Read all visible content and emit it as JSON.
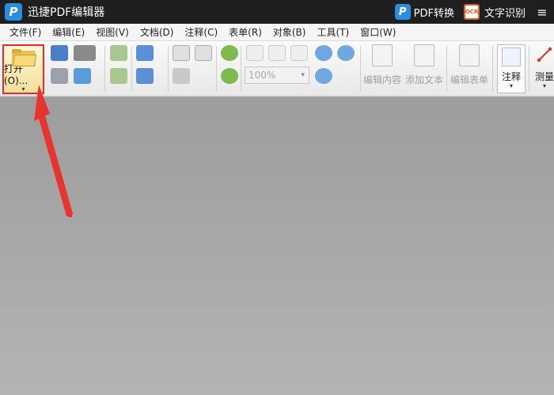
{
  "titlebar": {
    "logo_letter": "P",
    "title": "迅捷PDF编辑器",
    "pdf_convert_icon_letter": "P",
    "pdf_convert_label": "PDF转换",
    "ocr_icon_text": "OCR",
    "ocr_label": "文字识别",
    "menu_icon": "≡"
  },
  "menubar": {
    "items": [
      "文件(F)",
      "编辑(E)",
      "视图(V)",
      "文档(D)",
      "注释(C)",
      "表单(R)",
      "对象(B)",
      "工具(T)",
      "窗口(W)"
    ]
  },
  "toolbar": {
    "open_label": "打开(O)...",
    "open_caret": "▾",
    "zoom_value": "100%",
    "edit_content_label": "编辑内容",
    "add_text_label": "添加文本",
    "edit_form_label": "编辑表单",
    "annotate_label": "注释",
    "measure_label": "测量"
  },
  "colors": {
    "highlight_border": "#e32b2b",
    "annotation_arrow": "#e8332f",
    "titlebar_bg": "#1f1f1f",
    "brand_blue": "#2a8ee0"
  }
}
